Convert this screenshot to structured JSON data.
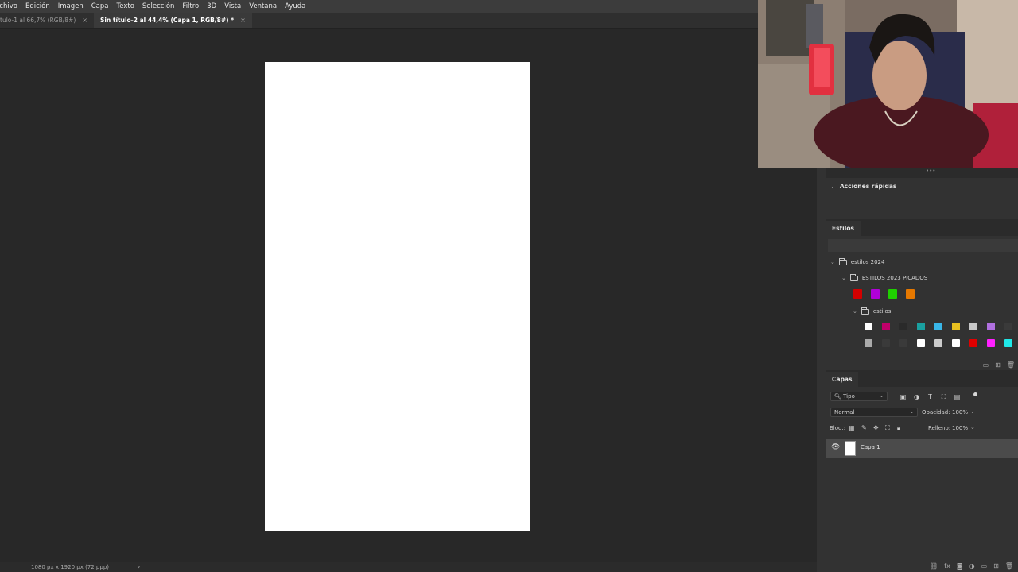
{
  "menu": [
    "rchivo",
    "Edición",
    "Imagen",
    "Capa",
    "Texto",
    "Selección",
    "Filtro",
    "3D",
    "Vista",
    "Ventana",
    "Ayuda"
  ],
  "tabs": [
    {
      "label": "tulo-1 al 66,7% (RGB/8#)",
      "close": "×"
    },
    {
      "label": "Sin título-2 al 44,4% (Capa 1, RGB/8#) *",
      "close": "×"
    }
  ],
  "status": {
    "info": "1080 px x 1920 px (72 ppp)",
    "arrow": "›"
  },
  "panels": {
    "grip": "•••",
    "actions": {
      "title": "Acciones rápidas"
    },
    "styles": {
      "tab": "Estilos",
      "tree": {
        "group1": "estilos 2024",
        "group2": "ESTILOS 2023 PICADOS",
        "group3": "estilos"
      },
      "swatch_colors_row1": [
        "#d40000",
        "#b000d8",
        "#1fd000",
        "#e67800"
      ],
      "swatch_colors_row2": [
        "#ffffff",
        "#c0006a",
        "#2a2a2a",
        "#1aa0a0",
        "#39b6e8",
        "#e8c020",
        "#c8c8c8",
        "#b070e0",
        "#3a3a3a"
      ],
      "swatch_colors_row3": [
        "#aaaaaa",
        "#3a3a3a",
        "#3a3a3a",
        "#ffffff",
        "#cccccc",
        "#ffffff",
        "#e00000",
        "#ff20ff",
        "#20e8e8"
      ]
    },
    "layers": {
      "tab": "Capas",
      "filter_label": "Tipo",
      "blend_mode": "Normal",
      "opacity_label": "Opacidad:",
      "opacity_value": "100%",
      "lock_label": "Bloq.:",
      "fill_label": "Relleno:",
      "fill_value": "100%",
      "layer_name": "Capa 1"
    }
  },
  "colors": {
    "accent": "#4b4b4b",
    "canvas": "#ffffff",
    "workspace": "#282828"
  }
}
